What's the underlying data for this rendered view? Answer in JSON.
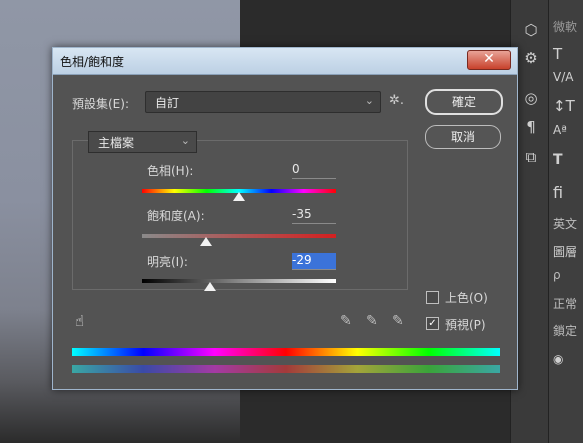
{
  "dialog": {
    "title": "色相/飽和度",
    "close_symbol": "✕",
    "preset_label": "預設集(E):",
    "preset_value": "自訂",
    "ok_label": "確定",
    "cancel_label": "取消",
    "channel_value": "主檔案",
    "sliders": {
      "hue": {
        "label": "色相(H):",
        "value": "0",
        "position": 0.5
      },
      "saturation": {
        "label": "飽和度(A):",
        "value": "-35",
        "position": 0.33
      },
      "lightness": {
        "label": "明亮(I):",
        "value": "-29",
        "position": 0.35
      }
    },
    "colorize_label": "上色(O)",
    "colorize_checked": false,
    "preview_label": "預視(P)",
    "preview_checked": true
  },
  "right_panel": {
    "items": [
      "微軟",
      "圖層",
      "正常",
      "鎖定",
      "英文"
    ]
  },
  "colors": {
    "dialog_bg": "#535353",
    "accent": "#3b73d9"
  }
}
